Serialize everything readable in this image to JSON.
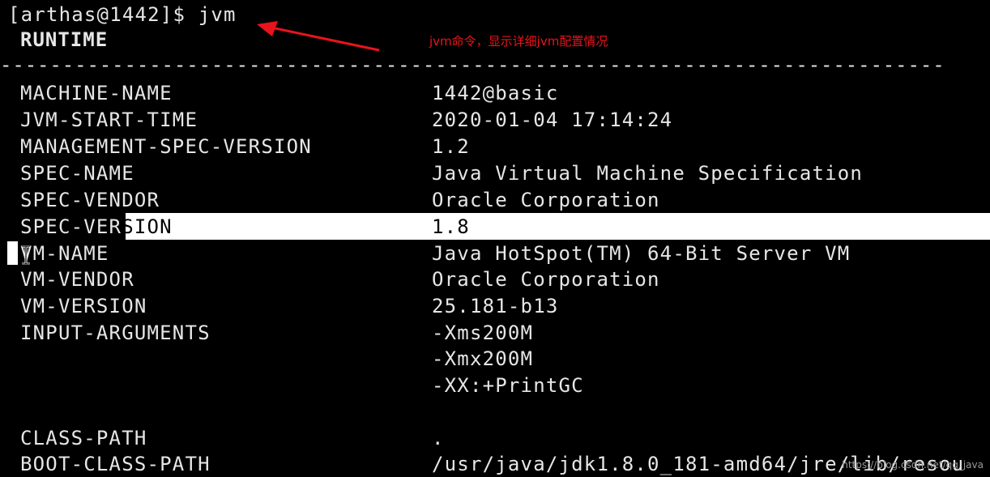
{
  "terminal": {
    "prompt": "[arthas@1442]$ jvm",
    "section_title": "RUNTIME",
    "divider": "----------------------------------------------------------------------------",
    "rows": [
      {
        "key": "MACHINE-NAME",
        "value": "1442@basic"
      },
      {
        "key": "JVM-START-TIME",
        "value": "2020-01-04 17:14:24"
      },
      {
        "key": "MANAGEMENT-SPEC-VERSION",
        "value": "1.2"
      },
      {
        "key": "SPEC-NAME",
        "value": "Java Virtual Machine Specification"
      },
      {
        "key": "SPEC-VENDOR",
        "value": "Oracle Corporation"
      },
      {
        "key_plain": "SPEC-VER",
        "key_selected": "SION",
        "value": "1.8"
      },
      {
        "key": "VM-NAME",
        "value": "Java HotSpot(TM) 64-Bit Server VM"
      },
      {
        "key": "VM-VENDOR",
        "value": "Oracle Corporation"
      },
      {
        "key": "VM-VERSION",
        "value": "25.181-b13"
      },
      {
        "key": "INPUT-ARGUMENTS",
        "value": "-Xms200M"
      },
      {
        "key": "",
        "value": "-Xmx200M"
      },
      {
        "key": "",
        "value": "-XX:+PrintGC"
      },
      {
        "key": "CLASS-PATH",
        "value": "."
      },
      {
        "key": "BOOT-CLASS-PATH",
        "value": "/usr/java/jdk1.8.0_181-amd64/jre/lib/resou"
      }
    ]
  },
  "annotation": {
    "text": "jvm命令，显示详细jvm配置情况",
    "color": "#e8141b"
  },
  "watermark": "https://blog.csdn.net/qq_java",
  "colors": {
    "background": "#000000",
    "text": "#e6e6e6",
    "selection": "#ffffff"
  }
}
